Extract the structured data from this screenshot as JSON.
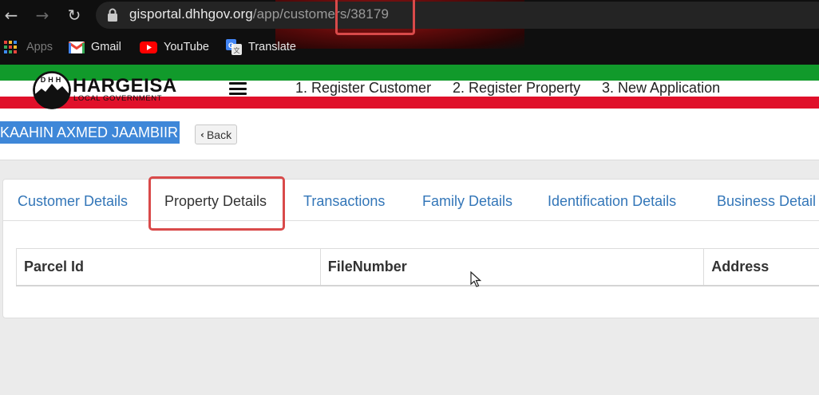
{
  "browser": {
    "url_host": "gisportal.dhhgov.org",
    "url_path": "/app/customers/38179",
    "bookmarks": [
      {
        "label": "Apps",
        "icon": "apps-grid-icon"
      },
      {
        "label": "Gmail",
        "icon": "gmail-icon"
      },
      {
        "label": "YouTube",
        "icon": "youtube-icon"
      },
      {
        "label": "Translate",
        "icon": "translate-icon"
      }
    ]
  },
  "header": {
    "brand_name": "HARGEISA",
    "brand_sub": "LOCAL GOVERNMENT",
    "logo_letters": "DHH",
    "nav": [
      {
        "label": "1. Register Customer"
      },
      {
        "label": "2. Register Property"
      },
      {
        "label": "3. New Application"
      }
    ],
    "colors": {
      "green": "#119a2b",
      "red": "#e0102a"
    }
  },
  "customer": {
    "name": "KAAHIN AXMED JAAMBIIR",
    "back_label": "Back"
  },
  "tabs": [
    {
      "label": "Customer Details",
      "active": false
    },
    {
      "label": "Property Details",
      "active": true
    },
    {
      "label": "Transactions",
      "active": false
    },
    {
      "label": "Family Details",
      "active": false
    },
    {
      "label": "Identification Details",
      "active": false
    },
    {
      "label": "Business Detail",
      "active": false
    }
  ],
  "table": {
    "columns": [
      "Parcel Id",
      "FileNumber",
      "Address"
    ]
  }
}
